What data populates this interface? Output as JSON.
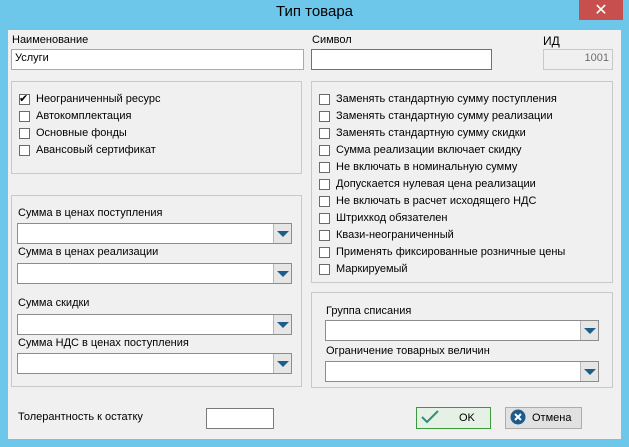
{
  "window": {
    "title": "Тип товара"
  },
  "fields": {
    "name_label": "Наименование",
    "name_value": "Услуги",
    "symbol_label": "Символ",
    "symbol_value": "",
    "id_label": "ИД",
    "id_value": "1001"
  },
  "left_checks": [
    {
      "label": "Неограниченный ресурс",
      "checked": true
    },
    {
      "label": "Автокомплектация",
      "checked": false
    },
    {
      "label": "Основные фонды",
      "checked": false
    },
    {
      "label": "Авансовый сертификат",
      "checked": false
    }
  ],
  "right_checks": [
    {
      "label": "Заменять стандартную сумму поступления",
      "checked": false
    },
    {
      "label": "Заменять стандартную сумму реализации",
      "checked": false
    },
    {
      "label": "Заменять стандартную сумму скидки",
      "checked": false
    },
    {
      "label": "Сумма реализации включает скидку",
      "checked": false
    },
    {
      "label": "Не включать в номинальную сумму",
      "checked": false
    },
    {
      "label": "Допускается нулевая цена реализации",
      "checked": false
    },
    {
      "label": "Не включать в расчет исходящего НДС",
      "checked": false
    },
    {
      "label": "Штрихкод обязателен",
      "checked": false
    },
    {
      "label": "Квази-неограниченный",
      "checked": false
    },
    {
      "label": "Применять фиксированные розничные цены",
      "checked": false
    },
    {
      "label": "Маркируемый",
      "checked": false
    }
  ],
  "sums": {
    "purchase_label": "Сумма в ценах поступления",
    "sale_label": "Сумма в ценах реализации",
    "discount_label": "Сумма скидки",
    "vat_label": "Сумма НДС в ценах поступления"
  },
  "writeoff": {
    "group_label": "Группа списания",
    "limit_label": "Ограничение товарных величин"
  },
  "tolerance": {
    "label": "Толерантность к остатку",
    "value": ""
  },
  "buttons": {
    "ok": "OK",
    "cancel": "Отмена"
  },
  "icons": {
    "close": "close-icon",
    "ok": "check-icon",
    "cancel": "cancel-icon"
  }
}
